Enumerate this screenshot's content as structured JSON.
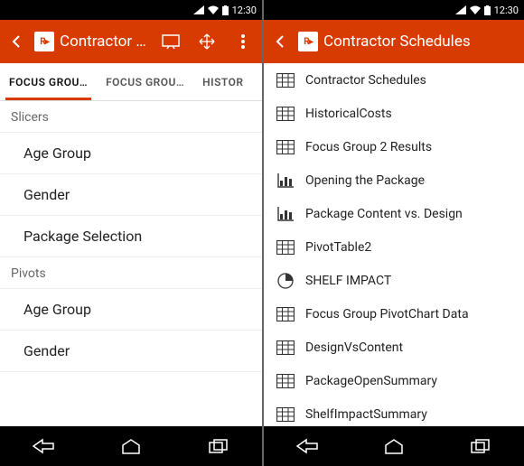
{
  "status": {
    "time": "12:30"
  },
  "left": {
    "header_title": "Contractor Sch…",
    "tabs": [
      {
        "label": "FOCUS GROU…",
        "active": true
      },
      {
        "label": "FOCUS GROU…",
        "active": false
      },
      {
        "label": "HISTOR",
        "active": false
      }
    ],
    "sections": [
      {
        "label": "Slicers",
        "items": [
          "Age Group",
          "Gender",
          "Package Selection"
        ]
      },
      {
        "label": "Pivots",
        "items": [
          "Age Group",
          "Gender"
        ]
      }
    ]
  },
  "right": {
    "header_title": "Contractor Schedules",
    "items": [
      {
        "icon": "table",
        "label": "Contractor Schedules"
      },
      {
        "icon": "table",
        "label": "HistoricalCosts"
      },
      {
        "icon": "table",
        "label": "Focus Group 2 Results"
      },
      {
        "icon": "barchart",
        "label": "Opening the Package"
      },
      {
        "icon": "barchart",
        "label": "Package Content vs. Design"
      },
      {
        "icon": "table",
        "label": "PivotTable2"
      },
      {
        "icon": "pie",
        "label": "SHELF IMPACT"
      },
      {
        "icon": "table",
        "label": "Focus Group PivotChart Data"
      },
      {
        "icon": "table",
        "label": "DesignVsContent"
      },
      {
        "icon": "table",
        "label": "PackageOpenSummary"
      },
      {
        "icon": "table",
        "label": "ShelfImpactSummary"
      }
    ]
  }
}
